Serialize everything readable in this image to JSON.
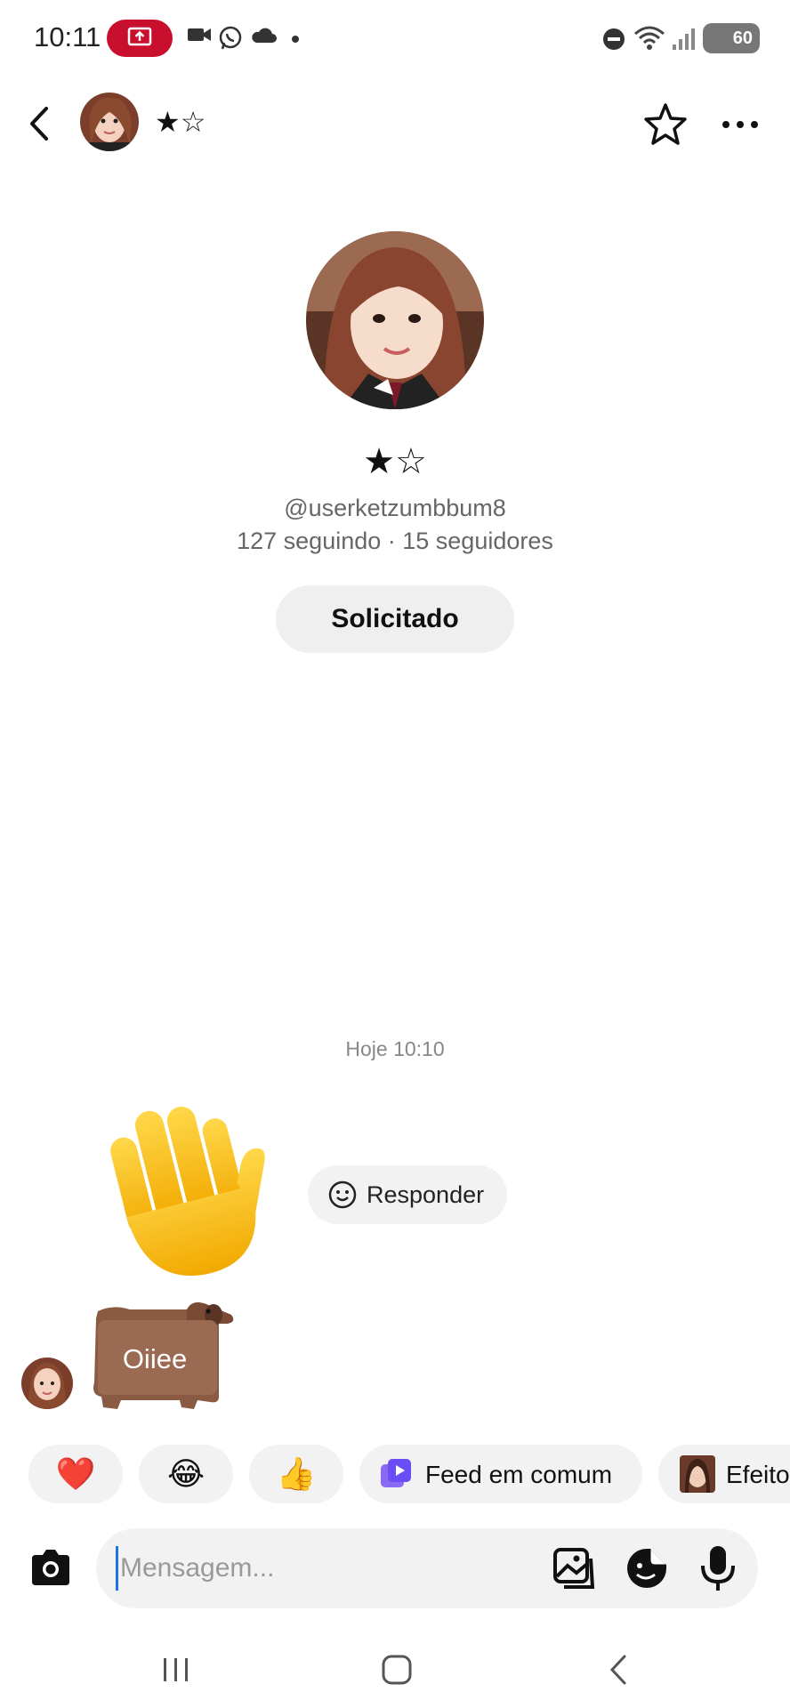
{
  "status_bar": {
    "time": "10:11",
    "battery": "60"
  },
  "header": {
    "name": "★☆"
  },
  "profile": {
    "name": "★☆",
    "handle": "@userketzumbbum8",
    "stats": "127 seguindo · 15 seguidores",
    "request_button": "Solicitado"
  },
  "chat": {
    "timestamp": "Hoje 10:10",
    "reply_button": "Responder",
    "sticker_text": "Oiiee"
  },
  "quick_replies": [
    {
      "emoji": "❤️"
    },
    {
      "emoji": "😂"
    },
    {
      "emoji": "👍"
    },
    {
      "label": "Feed em comum"
    },
    {
      "label": "Efeito"
    }
  ],
  "composer": {
    "placeholder": "Mensagem..."
  },
  "colors": {
    "accent_red": "#c8102e",
    "chip_bg": "#f2f2f2",
    "feed_icon": "#6a4df5"
  }
}
